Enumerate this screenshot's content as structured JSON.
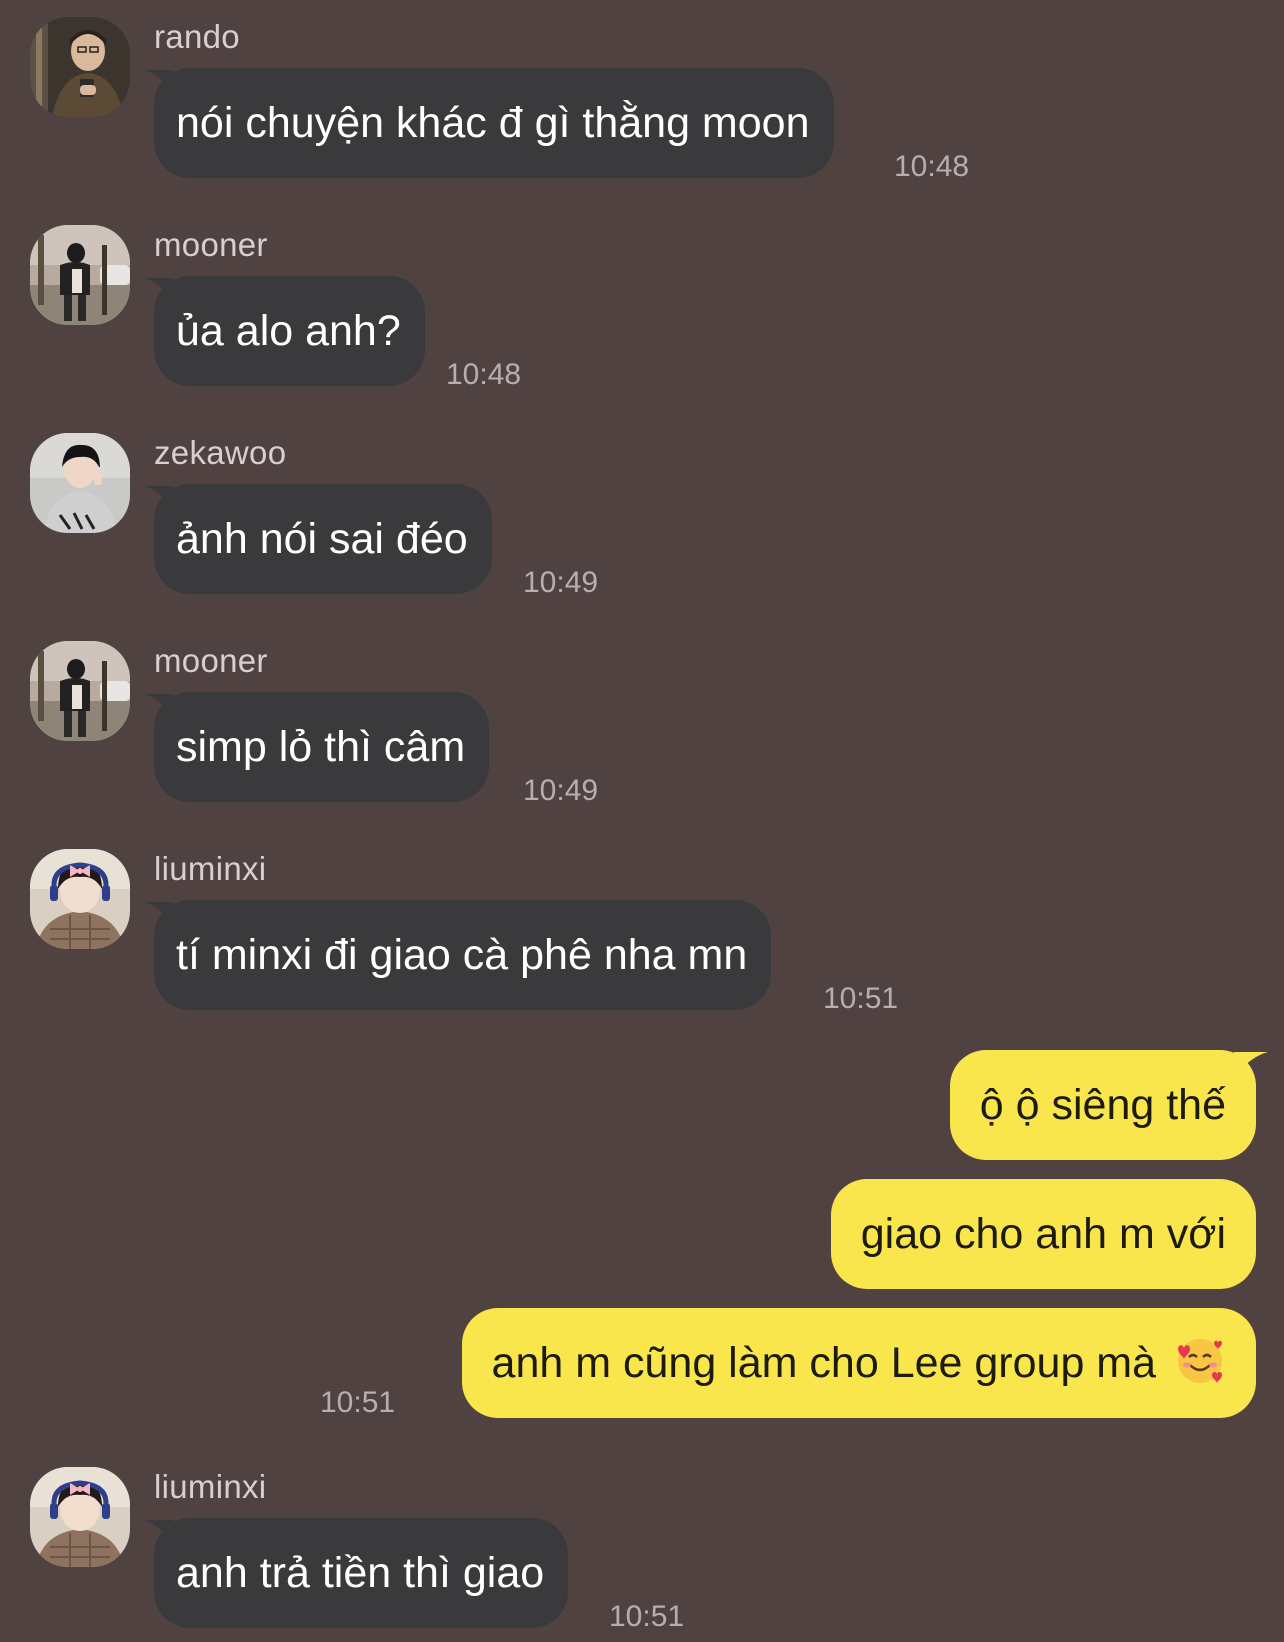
{
  "colors": {
    "background": "#514242",
    "incoming_bubble": "#3a393b",
    "outgoing_bubble": "#f9e54c"
  },
  "messages": [
    {
      "sender": "rando",
      "avatar": "rando-avatar",
      "text": "nói chuyện khác đ gì thằng moon",
      "time": "10:48"
    },
    {
      "sender": "mooner",
      "avatar": "mooner-avatar",
      "text": "ủa alo anh?",
      "time": "10:48"
    },
    {
      "sender": "zekawoo",
      "avatar": "zekawoo-avatar",
      "text": "ảnh nói sai đéo",
      "time": "10:49"
    },
    {
      "sender": "mooner",
      "avatar": "mooner-avatar",
      "text": "simp lỏ thì câm",
      "time": "10:49"
    },
    {
      "sender": "liuminxi",
      "avatar": "liuminxi-avatar",
      "text": "tí minxi đi giao cà phê nha mn",
      "time": "10:51"
    },
    {
      "sender": "liuminxi",
      "avatar": "liuminxi-avatar",
      "text": "anh trả tiền thì giao",
      "time": "10:51"
    }
  ],
  "outgoing": [
    {
      "text": "ộ ộ siêng thế"
    },
    {
      "text": "giao cho anh m với"
    },
    {
      "text": "anh m cũng làm cho Lee group mà",
      "emoji": "smiling-face-with-hearts-emoji",
      "time": "10:51"
    }
  ]
}
